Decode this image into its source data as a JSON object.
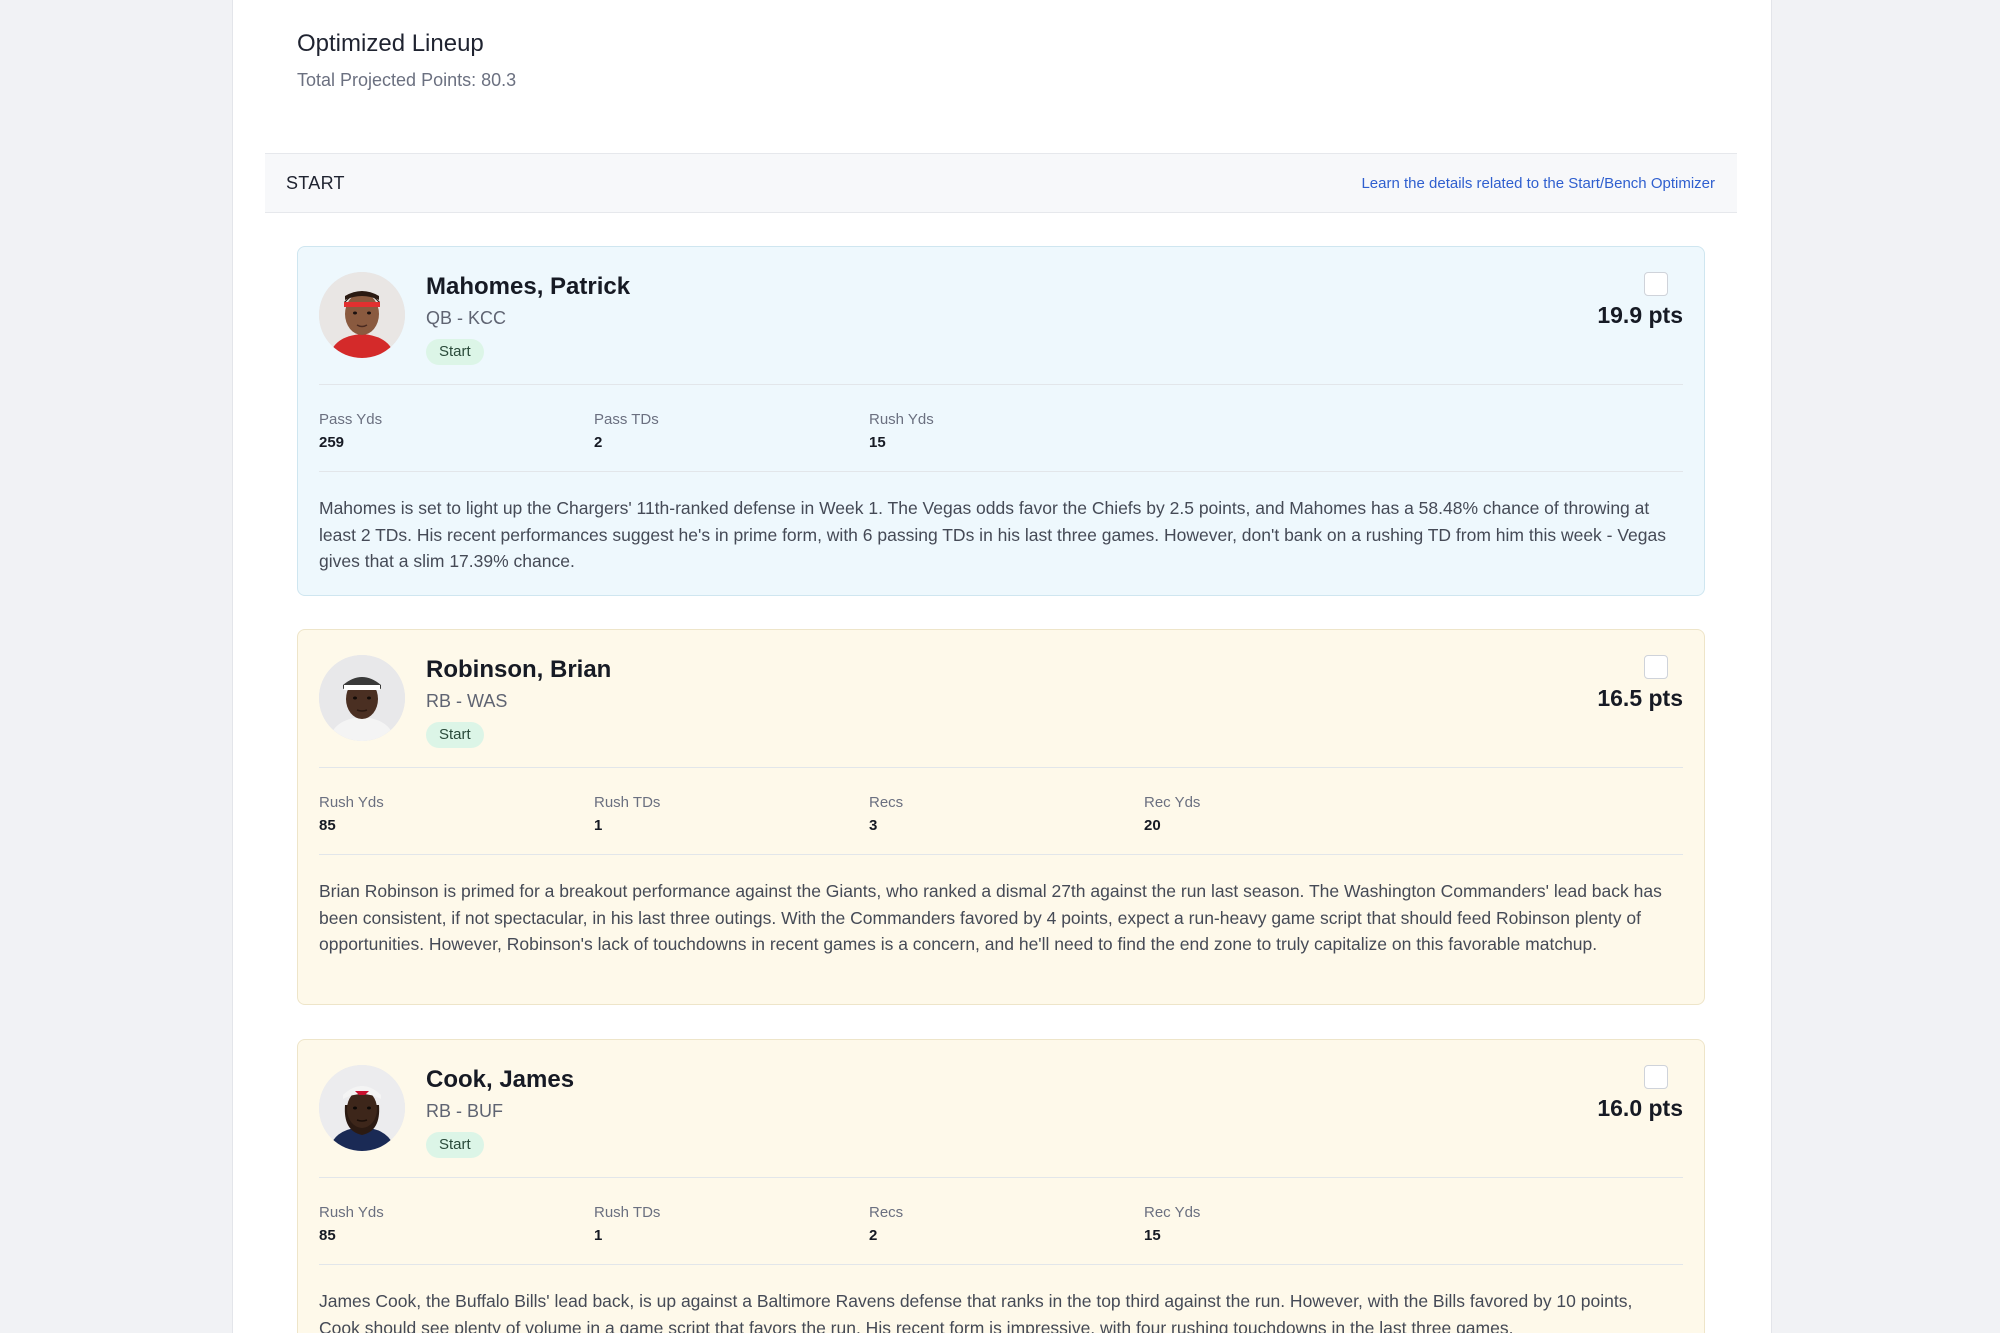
{
  "header": {
    "title": "Optimized Lineup",
    "total": "Total Projected Points: 80.3"
  },
  "section": {
    "label": "START",
    "link": "Learn the details related to the Start/Bench Optimizer"
  },
  "players": [
    {
      "name": "Mahomes, Patrick",
      "position": "QB - KCC",
      "badge": "Start",
      "points": "19.9 pts",
      "stats": [
        {
          "label": "Pass Yds",
          "value": "259"
        },
        {
          "label": "Pass TDs",
          "value": "2"
        },
        {
          "label": "Rush Yds",
          "value": "15"
        }
      ],
      "blurb": "Mahomes is set to light up the Chargers' 11th-ranked defense in Week 1. The Vegas odds favor the Chiefs by 2.5 points, and Mahomes has a 58.48% chance of throwing at least 2 TDs. His recent performances suggest he's in prime form, with 6 passing TDs in his last three games. However, don't bank on a rushing TD from him this week - Vegas gives that a slim 17.39% chance."
    },
    {
      "name": "Robinson, Brian",
      "position": "RB - WAS",
      "badge": "Start",
      "points": "16.5 pts",
      "stats": [
        {
          "label": "Rush Yds",
          "value": "85"
        },
        {
          "label": "Rush TDs",
          "value": "1"
        },
        {
          "label": "Recs",
          "value": "3"
        },
        {
          "label": "Rec Yds",
          "value": "20"
        }
      ],
      "blurb": "Brian Robinson is primed for a breakout performance against the Giants, who ranked a dismal 27th against the run last season. The Washington Commanders' lead back has been consistent, if not spectacular, in his last three outings. With the Commanders favored by 4 points, expect a run-heavy game script that should feed Robinson plenty of opportunities. However, Robinson's lack of touchdowns in recent games is a concern, and he'll need to find the end zone to truly capitalize on this favorable matchup."
    },
    {
      "name": "Cook, James",
      "position": "RB - BUF",
      "badge": "Start",
      "points": "16.0 pts",
      "stats": [
        {
          "label": "Rush Yds",
          "value": "85"
        },
        {
          "label": "Rush TDs",
          "value": "1"
        },
        {
          "label": "Recs",
          "value": "2"
        },
        {
          "label": "Rec Yds",
          "value": "15"
        }
      ],
      "blurb": "James Cook, the Buffalo Bills' lead back, is up against a Baltimore Ravens defense that ranks in the top third against the run. However, with the Bills favored by 10 points, Cook should see plenty of volume in a game script that favors the run. His recent form is impressive, with four rushing touchdowns in the last three games."
    }
  ],
  "colors": {
    "qb_card": "#eef8fd",
    "rb_card": "#fef9ea",
    "badge": "#dcf5e7",
    "link": "#2f5fcf"
  }
}
